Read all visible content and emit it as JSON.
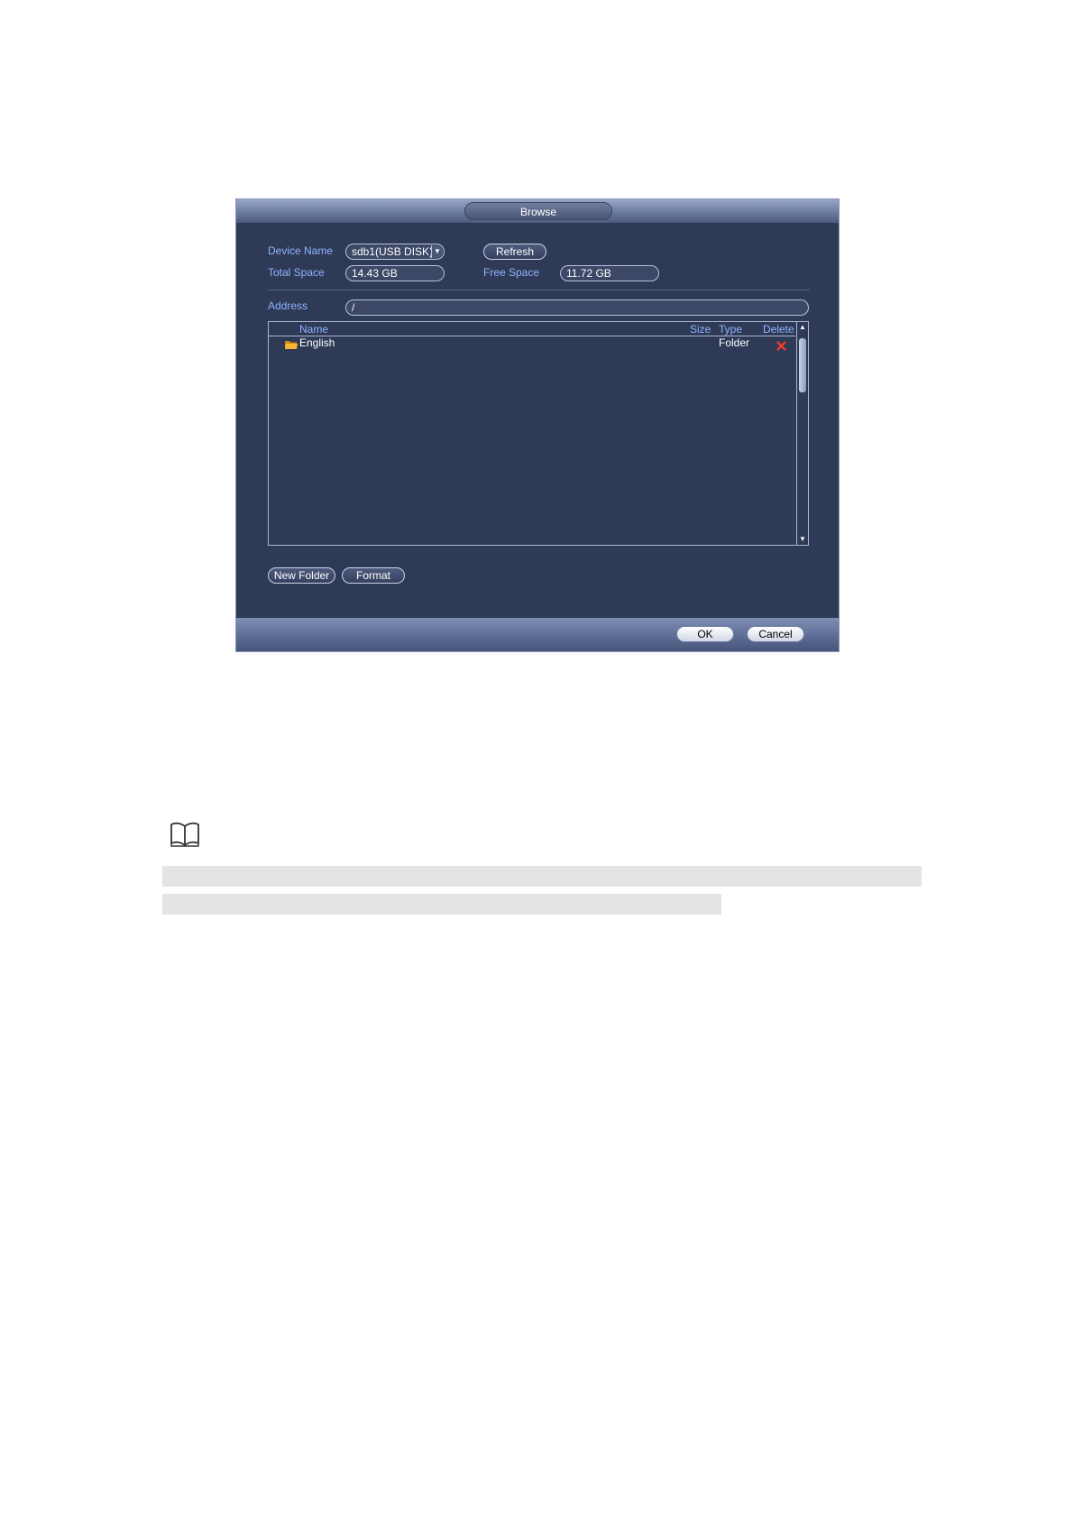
{
  "dialog": {
    "title": "Browse",
    "device_name_label": "Device Name",
    "device_name_value": "sdb1(USB DISK)",
    "refresh_label": "Refresh",
    "total_space_label": "Total Space",
    "total_space_value": "14.43 GB",
    "free_space_label": "Free Space",
    "free_space_value": "11.72 GB",
    "address_label": "Address",
    "address_value": "/",
    "columns": {
      "name": "Name",
      "size": "Size",
      "type": "Type",
      "delete": "Delete"
    },
    "files": [
      {
        "name": "English",
        "size": "",
        "type": "Folder",
        "icon": "folder-icon"
      }
    ],
    "new_folder_label": "New Folder",
    "format_label": "Format",
    "ok_label": "OK",
    "cancel_label": "Cancel"
  },
  "colors": {
    "dialog_bg": "#2f3a57",
    "label_blue": "#8fb4ff",
    "delete_red": "#ff3b1f",
    "folder_orange": "#f5a623"
  },
  "note": {
    "icon": "book-icon"
  }
}
